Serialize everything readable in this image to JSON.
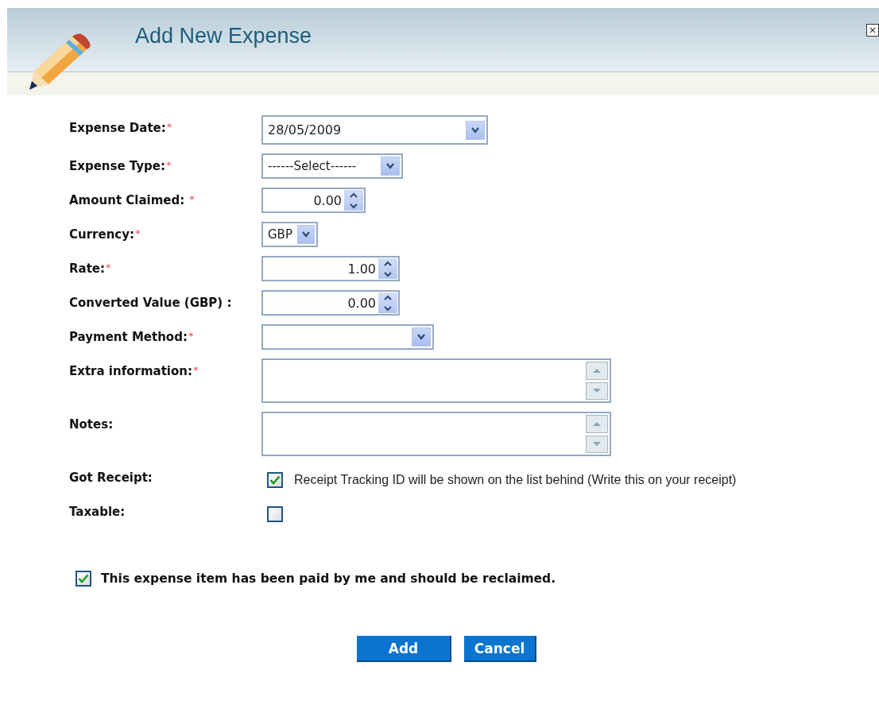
{
  "dialog": {
    "title": "Add New Expense",
    "close_label": "×"
  },
  "fields": [
    {
      "kind": "date",
      "label": "Expense Date:",
      "required_mark": "*",
      "value": "28/05/2009"
    },
    {
      "kind": "select",
      "label": "Expense Type:",
      "required_mark": "*",
      "value": "------Select------"
    },
    {
      "kind": "spin",
      "label": "Amount Claimed:",
      "required_mark": "*",
      "value": "0.00"
    },
    {
      "kind": "select",
      "label": "Currency:",
      "required_mark": "*",
      "value": "GBP"
    },
    {
      "kind": "spin",
      "label": "Rate:",
      "required_mark": "*",
      "value": "1.00"
    },
    {
      "kind": "spin",
      "label": "Converted Value (GBP) :",
      "value": "0.00"
    },
    {
      "kind": "select",
      "label": "Payment Method:",
      "required_mark": "*"
    },
    {
      "kind": "textarea",
      "label": "Extra information:",
      "required_mark": "*"
    },
    {
      "kind": "textarea",
      "label": "Notes:"
    },
    {
      "kind": "checkbox",
      "label": "Got Receipt:",
      "checked": true,
      "text": "Receipt Tracking ID will be shown on the list behind (Write this on your receipt)"
    },
    {
      "kind": "checkbox",
      "label": "Taxable:",
      "checked": false
    }
  ],
  "reclaim": {
    "checked": true,
    "text": "This expense item has been paid by me and should be reclaimed."
  },
  "buttons": [
    "Add",
    "Cancel"
  ]
}
